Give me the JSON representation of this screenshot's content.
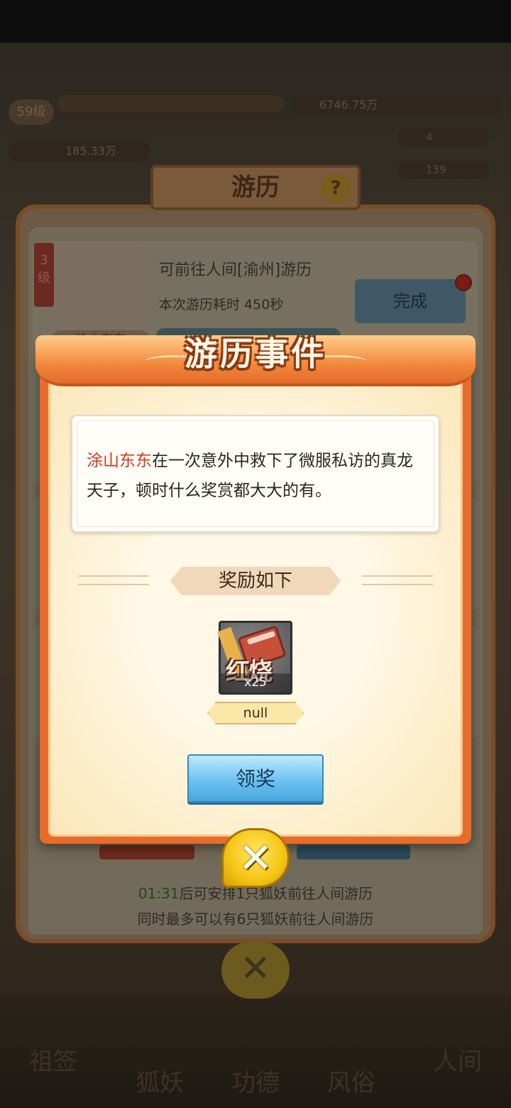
{
  "background": {
    "player_level": "59级",
    "power_value": "185.33万",
    "resource_value": "6746.75万",
    "stat_a": "4",
    "stat_b": "139",
    "nav_tabs": [
      "祖签",
      "狐妖",
      "功德",
      "风俗",
      "人间"
    ]
  },
  "travel_panel": {
    "title": "游历",
    "help_icon": "?",
    "card": {
      "rank": "3级",
      "character_name": "涂山东东",
      "destination": "可前往人间[渝州]游历",
      "duration": "本次游历耗时 450秒",
      "done_button": "完成"
    },
    "footer": {
      "countdown": "01:31",
      "line1_suffix": "后可安排1只狐妖前往人间游历",
      "line2": "同时最多可以有6只狐妖前往人间游历"
    }
  },
  "event_modal": {
    "title": "游历事件",
    "story": {
      "hero_name": "涂山东东",
      "text": "在一次意外中救下了微服私访的真龙天子，顿时什么奖赏都大大的有。"
    },
    "reward_header": "奖励如下",
    "reward_item": {
      "icon": "red-meat-icon",
      "icon_glyph": "红烧",
      "quantity": "x25",
      "label": "null"
    },
    "claim_button": "领奖",
    "close_button": "✕"
  },
  "colors": {
    "hero_name": "#d2391e",
    "modal_frame": "#e76b2a",
    "claim_button": "#6cc2f0",
    "close_button": "#f5c514"
  }
}
